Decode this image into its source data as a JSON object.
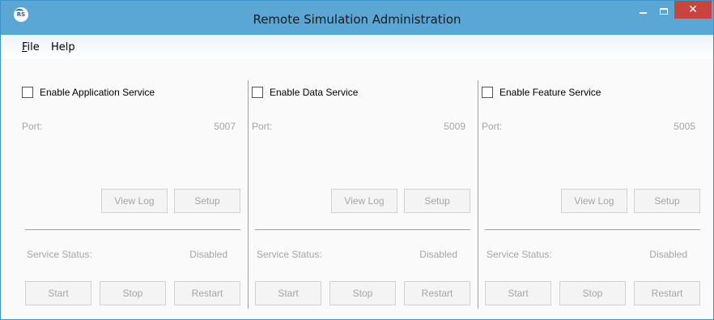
{
  "window": {
    "title": "Remote Simulation Administration",
    "icon": "app-logo-icon",
    "icon_text": "RS",
    "minimize_icon": "minimize-icon",
    "maximize_icon": "maximize-icon",
    "close_glyph": "✕",
    "colors": {
      "titlebar": "#5aa7d6",
      "close": "#c7453c",
      "disabled_text": "#a6a6a6"
    }
  },
  "menu": {
    "file_first": "F",
    "file_rest": "ile",
    "help": "Help"
  },
  "panels": [
    {
      "checkbox_label": "Enable Application Service",
      "checked": false,
      "port_label": "Port:",
      "port_value": "5007",
      "view_log": "View Log",
      "setup": "Setup",
      "status_label": "Service Status:",
      "status_value": "Disabled",
      "start": "Start",
      "stop": "Stop",
      "restart": "Restart"
    },
    {
      "checkbox_label": "Enable Data Service",
      "checked": false,
      "port_label": "Port:",
      "port_value": "5009",
      "view_log": "View Log",
      "setup": "Setup",
      "status_label": "Service Status:",
      "status_value": "Disabled",
      "start": "Start",
      "stop": "Stop",
      "restart": "Restart"
    },
    {
      "checkbox_label": "Enable Feature Service",
      "checked": false,
      "port_label": "Port:",
      "port_value": "5005",
      "view_log": "View Log",
      "setup": "Setup",
      "status_label": "Service Status:",
      "status_value": "Disabled",
      "start": "Start",
      "stop": "Stop",
      "restart": "Restart"
    }
  ]
}
